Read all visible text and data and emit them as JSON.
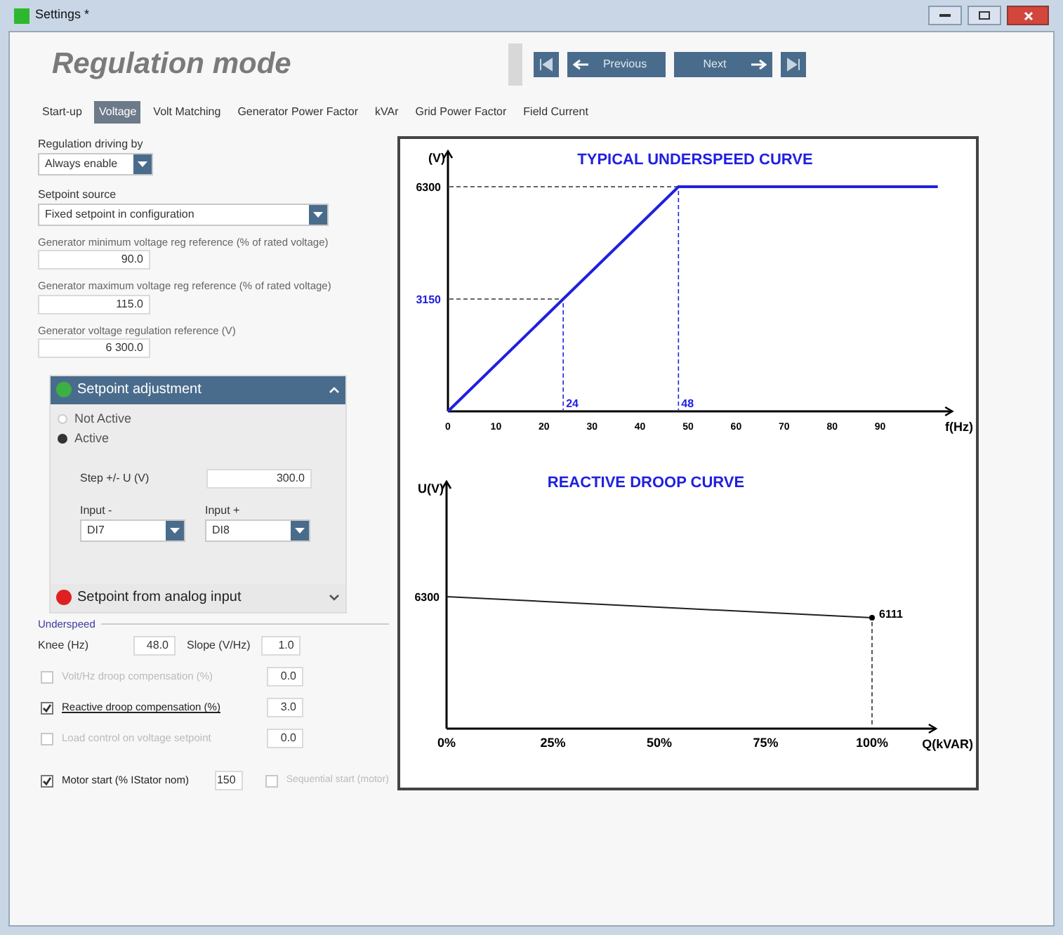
{
  "window": {
    "title": "Settings *"
  },
  "header": {
    "title": "Regulation mode",
    "nav": [
      {
        "kind": "first"
      },
      {
        "kind": "prev",
        "label": "Previous"
      },
      {
        "kind": "next",
        "label": "Next"
      },
      {
        "kind": "last"
      }
    ]
  },
  "tabs": [
    {
      "label": "Start-up",
      "selected": false
    },
    {
      "label": "Voltage",
      "selected": true
    },
    {
      "label": "Volt Matching",
      "selected": false
    },
    {
      "label": "Generator Power Factor",
      "selected": false
    },
    {
      "label": "kVAr",
      "selected": false
    },
    {
      "label": "Grid Power Factor",
      "selected": false
    },
    {
      "label": "Field Current",
      "selected": false
    }
  ],
  "regulation_driving": {
    "label": "Regulation driving by",
    "value": "Always enable"
  },
  "setpoint_source": {
    "label": "Setpoint source",
    "value": "Fixed setpoint in configuration"
  },
  "fields": [
    {
      "label": "Generator minimum voltage reg reference (% of rated voltage)",
      "value": "90.0"
    },
    {
      "label": "Generator maximum voltage reg reference (% of rated voltage)",
      "value": "115.0"
    },
    {
      "label": "Generator voltage regulation reference (V)",
      "value": "6 300.0"
    }
  ],
  "setpoint_adjustment": {
    "title": "Setpoint adjustment",
    "color": "#3cb043",
    "expanded": true,
    "options": [
      {
        "label": "Not Active",
        "selected": false
      },
      {
        "label": "Active",
        "selected": true
      }
    ],
    "step": {
      "label": "Step +/- U (V)",
      "value": "300.0"
    },
    "inputs": [
      {
        "label": "Input -",
        "value": "DI7"
      },
      {
        "label": "Input +",
        "value": "DI8"
      }
    ]
  },
  "analog_setpoint": {
    "title": "Setpoint from analog input",
    "color": "#e02020",
    "expanded": false
  },
  "underspeed": {
    "legend": "Underspeed",
    "knee": {
      "label": "Knee (Hz)",
      "value": "48.0"
    },
    "slope": {
      "label": "Slope (V/Hz)",
      "value": "1.0"
    }
  },
  "options": [
    {
      "label": "Volt/Hz droop compensation (%)",
      "value": "0.0",
      "checked": false,
      "disabled": true
    },
    {
      "label": "Reactive droop compensation (%)",
      "value": "3.0",
      "checked": true,
      "disabled": false
    },
    {
      "label": "Load control on voltage setpoint",
      "value": "0.0",
      "checked": false,
      "disabled": true
    }
  ],
  "motor_start": {
    "label": "Motor start (% IStator nom)",
    "value": "150",
    "checked": true
  },
  "sequential_start": {
    "label": "Sequential start (motor)",
    "checked": false,
    "disabled": true
  },
  "charts": [
    {
      "chart_data": {
        "type": "line",
        "title": "TYPICAL UNDERSPEED CURVE",
        "xlabel": "f(Hz)",
        "ylabel": "(V)",
        "x": [
          0,
          24,
          48,
          102
        ],
        "series": [
          {
            "color": "#2020e0",
            "values": [
              0,
              3150,
              6300,
              6300
            ]
          }
        ],
        "xlim": [
          0,
          105
        ],
        "ylim": [
          0,
          7300
        ],
        "xticks": [
          0,
          10,
          20,
          30,
          40,
          50,
          60,
          70,
          80,
          90
        ],
        "yticks": [
          3150,
          6300
        ],
        "ref_lines": [
          {
            "axis": "y",
            "value": 3150
          },
          {
            "axis": "y",
            "value": 6300
          },
          {
            "axis": "x",
            "value": 24,
            "label": "24"
          },
          {
            "axis": "x",
            "value": 48,
            "label": "48"
          }
        ]
      }
    },
    {
      "chart_data": {
        "type": "line",
        "title": "REACTIVE DROOP CURVE",
        "xlabel": "Q(kVAR)",
        "ylabel": "U(V)",
        "x": [
          0,
          100
        ],
        "series": [
          {
            "color": "#202020",
            "values": [
              6300,
              6111
            ]
          }
        ],
        "xlim": [
          0,
          115
        ],
        "xticks": [
          {
            "value": 0,
            "label": "0%"
          },
          {
            "value": 25,
            "label": "25%"
          },
          {
            "value": 50,
            "label": "50%"
          },
          {
            "value": 75,
            "label": "75%"
          },
          {
            "value": 100,
            "label": "100%"
          }
        ],
        "data_labels": true
      }
    }
  ]
}
